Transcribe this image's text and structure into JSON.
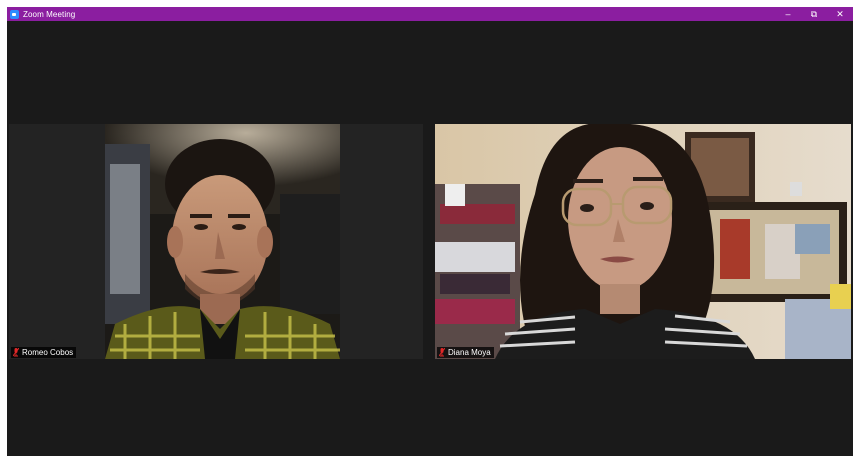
{
  "window": {
    "title": "Zoom Meeting",
    "icon": "zoom-icon",
    "controls": {
      "minimize": "–",
      "restore": "⧉",
      "close": "✕"
    }
  },
  "participants": [
    {
      "name": "Romeo Cobos",
      "mic_icon": "muted-mic-icon"
    },
    {
      "name": "Diana Moya",
      "mic_icon": "muted-mic-icon"
    }
  ],
  "colors": {
    "titlebar": "#8b1ea0",
    "background": "#1a1a1a",
    "tile": "#232323",
    "muted_mic": "#e02828"
  }
}
